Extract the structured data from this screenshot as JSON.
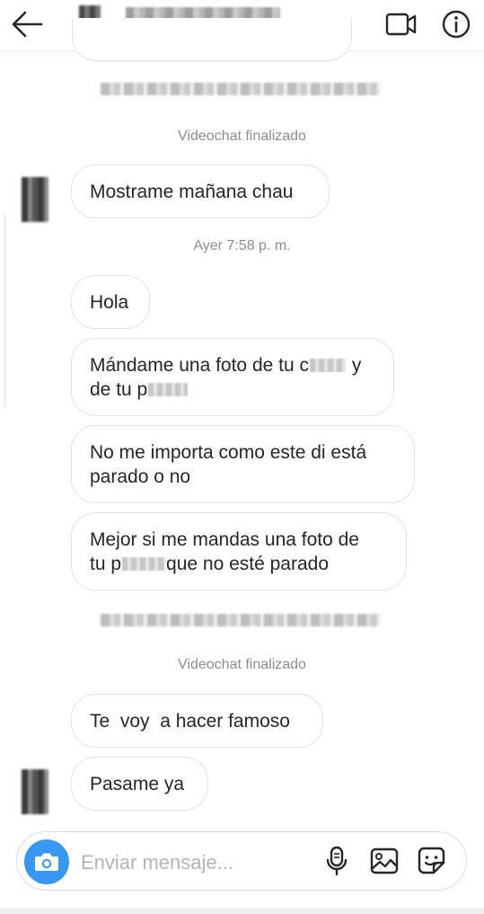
{
  "header": {
    "back_icon": "arrow-left-icon",
    "video_icon": "video-camera-icon",
    "info_icon": "info-icon"
  },
  "messages": {
    "system_1": "Videochat finalizado",
    "m1": "Mostrame mañana chau",
    "timestamp": "Ayer 7:58 p. m.",
    "m2": "Hola",
    "m3_a": "Mándame una foto de tu c",
    "m3_b": "y",
    "m3_c": "de tu p",
    "m4_a": "No me importa como este di está",
    "m4_b": "parado o no",
    "m5_a": "Mejor si me mandas una foto de",
    "m5_b": "tu p",
    "m5_c": "que no esté parado",
    "system_2": "Videochat finalizado",
    "m6": "Te  voy  a hacer famoso",
    "m7": "Pasame ya"
  },
  "composer": {
    "placeholder": "Enviar mensaje...",
    "camera_icon": "camera-icon",
    "mic_icon": "microphone-icon",
    "gallery_icon": "image-icon",
    "sticker_icon": "sticker-icon",
    "camera_color": "#3897f0"
  }
}
